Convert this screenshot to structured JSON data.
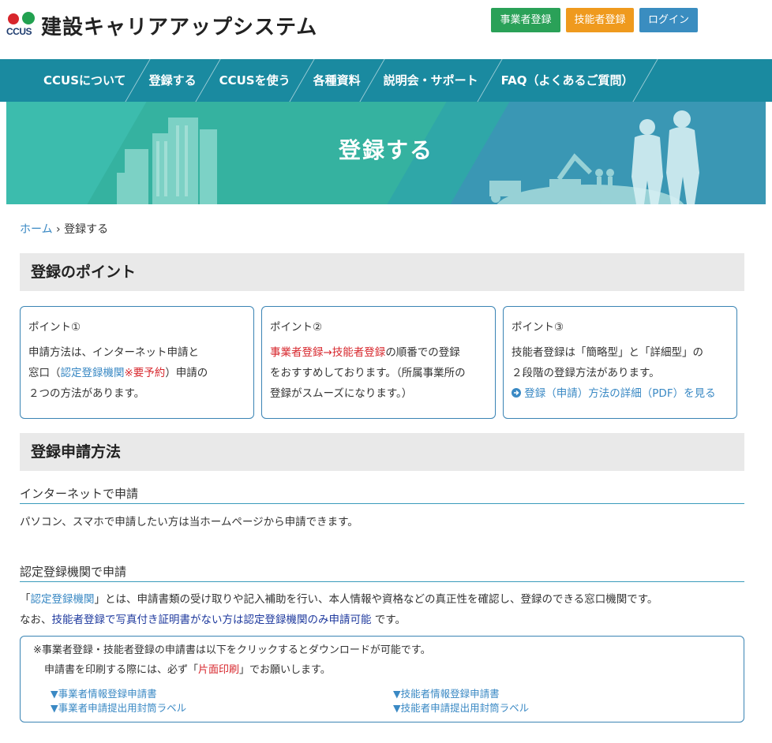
{
  "header": {
    "logo_mark_text": "CCUS",
    "logo_text": "建設キャリアアップシステム",
    "buttons": {
      "business_register": "事業者登録",
      "technician_register": "技能者登録",
      "login": "ログイン"
    }
  },
  "nav": {
    "items": [
      "CCUSについて",
      "登録する",
      "CCUSを使う",
      "各種資料",
      "説明会・サポート",
      "FAQ（よくあるご質問）"
    ]
  },
  "hero": {
    "title": "登録する"
  },
  "breadcrumb": {
    "home": "ホーム",
    "sep": "›",
    "current": "登録する"
  },
  "points_section": {
    "title": "登録のポイント",
    "p1": {
      "title": "ポイント①",
      "line1": "申請方法は、インターネット申請と",
      "line2_a": "窓口（",
      "line2_link": "認定登録機関",
      "line2_red": "※要予約",
      "line2_b": "）申請の",
      "line3": "２つの方法があります。"
    },
    "p2": {
      "title": "ポイント②",
      "red": "事業者登録→技能者登録",
      "line1_b": "の順番での登録",
      "line2": "をおすすめしております。（所属事業所の",
      "line3": "登録がスムーズになります。）"
    },
    "p3": {
      "title": "ポイント③",
      "line1": "技能者登録は「簡略型」と「詳細型」の",
      "line2": "２段階の登録方法があります。",
      "link": "登録（申請）方法の詳細（PDF）を見る"
    }
  },
  "method_section": {
    "title": "登録申請方法",
    "internet_head": "インターネットで申請",
    "internet_text": "パソコン、スマホで申請したい方は当ホームページから申請できます。",
    "agency_head": "認定登録機関で申請",
    "agency_text1_a": "「",
    "agency_text1_link": "認定登録機関",
    "agency_text1_b": "」とは、申請書類の受け取りや記入補助を行い、本人情報や資格などの真正性を確認し、登録のできる窓口機関です。",
    "agency_text2_a": "なお、",
    "agency_text2_navy": "技能者登録で写真付き証明書がない方は認定登録機関のみ申請可能",
    "agency_text2_b": " です。"
  },
  "download_box": {
    "line1": "※事業者登録・技能者登録の申請書は以下をクリックするとダウンロードが可能です。",
    "line2_a": "申請書を印刷する際には、必ず「",
    "line2_red": "片面印刷",
    "line2_b": "」でお願いします。",
    "links": {
      "biz_form": "▼事業者情報登録申請書",
      "biz_label": "▼事業者申請提出用封筒ラベル",
      "tech_form": "▼技能者情報登録申請書",
      "tech_label": "▼技能者申請提出用封筒ラベル"
    }
  },
  "colors": {
    "nav_bg": "#1a8aa0",
    "hero_bg": "#35b2a0",
    "accent_link": "#3a89c4",
    "red": "#d7262c",
    "btn_green": "#2aa158",
    "btn_orange": "#ef9a1e",
    "btn_blue": "#3a8dc0"
  }
}
